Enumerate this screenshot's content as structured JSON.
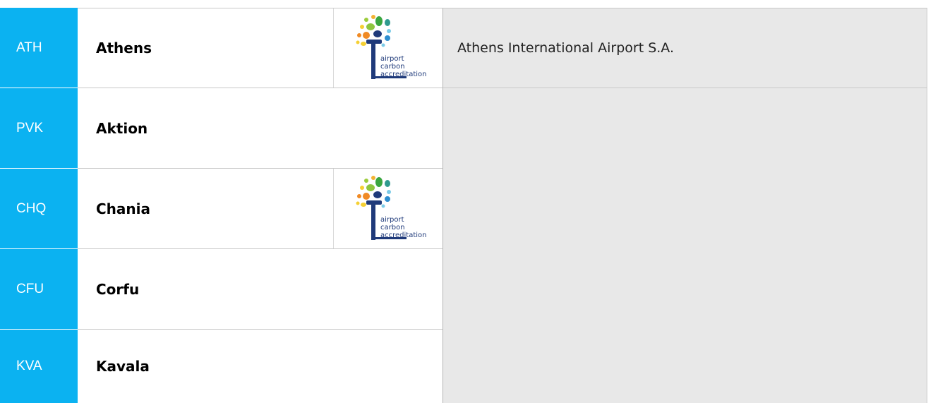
{
  "airports": [
    {
      "code": "ATH",
      "name": "Athens",
      "carbon_accredited": true
    },
    {
      "code": "PVK",
      "name": "Aktion",
      "carbon_accredited": false
    },
    {
      "code": "CHQ",
      "name": "Chania",
      "carbon_accredited": true
    },
    {
      "code": "CFU",
      "name": "Corfu",
      "carbon_accredited": false
    },
    {
      "code": "KVA",
      "name": "Kavala",
      "carbon_accredited": false
    }
  ],
  "accreditation_logo": {
    "line1": "airport",
    "line2": "carbon",
    "line3": "accreditation",
    "icon": "airport-carbon-accreditation-tree-logo"
  },
  "operator": {
    "name": "Athens International Airport S.A."
  },
  "colors": {
    "code_background": "#0bb2f1",
    "panel_background": "#e8e8e8",
    "logo_text": "#1f3a7a"
  }
}
